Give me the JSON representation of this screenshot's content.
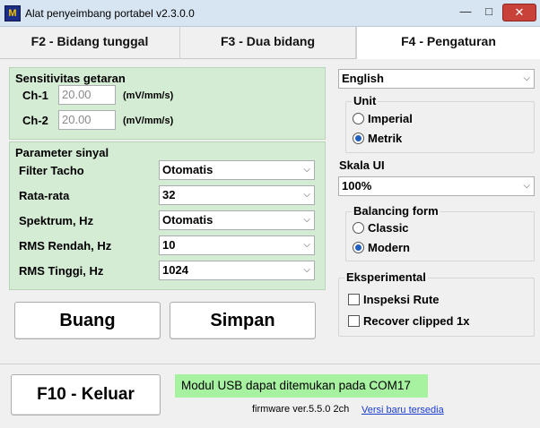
{
  "window": {
    "icon_text": "M",
    "title": "Alat penyeimbang portabel v2.3.0.0",
    "minimize": "—",
    "maximize": "□",
    "close": "✕"
  },
  "tabs": [
    {
      "label": "F2 - Bidang tunggal"
    },
    {
      "label": "F3 - Dua bidang"
    },
    {
      "label": "F4 - Pengaturan"
    }
  ],
  "vibration": {
    "title": "Sensitivitas getaran",
    "ch1_label": "Ch-1",
    "ch1_value": "20.00",
    "ch2_label": "Ch-2",
    "ch2_value": "20.00",
    "unit": "(mV/mm/s)"
  },
  "signal": {
    "title": "Parameter sinyal",
    "rows": [
      {
        "label": "Filter Tacho",
        "value": "Otomatis"
      },
      {
        "label": "Rata-rata",
        "value": "32"
      },
      {
        "label": "Spektrum, Hz",
        "value": "Otomatis"
      },
      {
        "label": "RMS Rendah, Hz",
        "value": "10"
      },
      {
        "label": "RMS Tinggi, Hz",
        "value": "1024"
      }
    ]
  },
  "actions": {
    "discard": "Buang",
    "save": "Simpan"
  },
  "settings": {
    "language": "English",
    "unit_title": "Unit",
    "unit_imperial": "Imperial",
    "unit_metric": "Metrik",
    "scale_title": "Skala UI",
    "scale_value": "100%",
    "form_title": "Balancing form",
    "form_classic": "Classic",
    "form_modern": "Modern",
    "exp_title": "Eksperimental",
    "exp_route": "Inspeksi Rute",
    "exp_clipped": "Recover clipped 1x"
  },
  "footer": {
    "exit": "F10 - Keluar",
    "status": "Modul USB dapat ditemukan pada COM17",
    "firmware": "firmware ver.5.5.0 2ch",
    "update_link": "Versi baru tersedia"
  },
  "colors": {
    "panel_green": "#d5ecd4",
    "status_green": "#a6f2a0",
    "radio_blue": "#1f5fbf",
    "link_blue": "#1a3ccf",
    "close_red": "#c8423a"
  }
}
